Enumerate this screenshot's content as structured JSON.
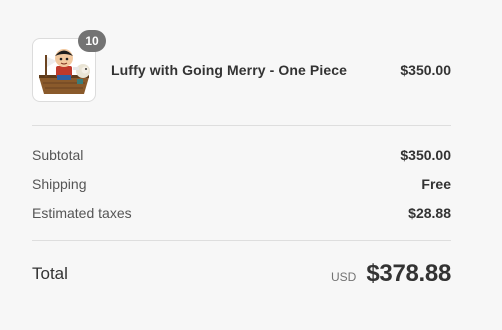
{
  "line_item": {
    "image_alt": "Luffy with Going Merry - One Piece",
    "quantity": "10",
    "name": "Luffy with Going Merry - One Piece",
    "price": "$350.00"
  },
  "totals": {
    "subtotal_label": "Subtotal",
    "subtotal_value": "$350.00",
    "shipping_label": "Shipping",
    "shipping_value": "Free",
    "taxes_label": "Estimated taxes",
    "taxes_value": "$28.88"
  },
  "grand_total": {
    "label": "Total",
    "currency": "USD",
    "amount": "$378.88"
  }
}
